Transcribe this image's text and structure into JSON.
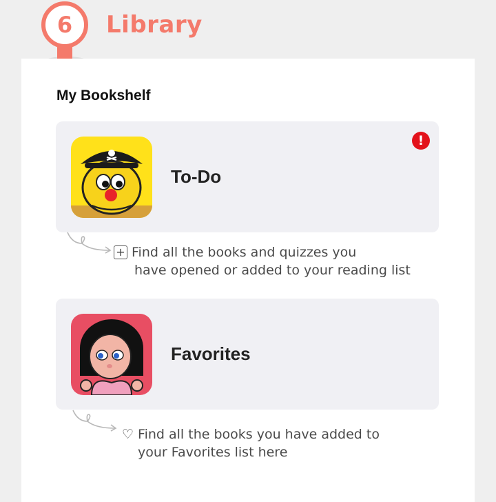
{
  "header": {
    "step_number": "6",
    "title": "Library",
    "accent_color": "#f47a6b"
  },
  "bookshelf": {
    "heading": "My Bookshelf",
    "cards": [
      {
        "id": "todo",
        "label": "To-Do",
        "icon": "pirate-character-thumbnail",
        "badge": "!",
        "badge_color": "#e3121b",
        "hint_icon": "+",
        "hint_lines": [
          "Find all the books and quizzes you",
          "have opened or added to your reading list"
        ]
      },
      {
        "id": "favorites",
        "label": "Favorites",
        "icon": "girl-with-heart-thumbnail",
        "hint_icon": "♡",
        "hint_lines": [
          "Find all the books you have added to",
          "your Favorites list here"
        ]
      }
    ]
  }
}
